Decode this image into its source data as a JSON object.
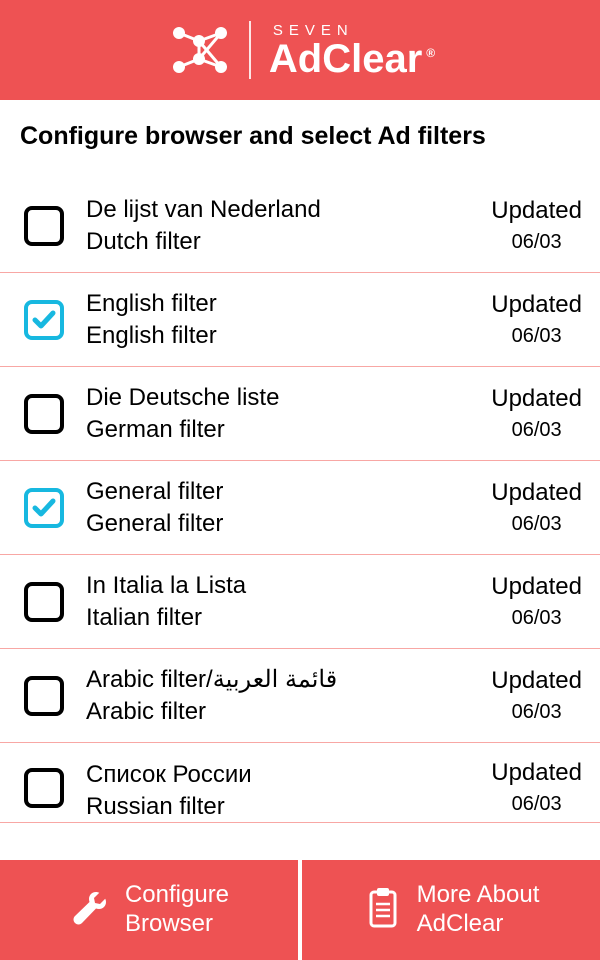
{
  "header": {
    "brand_small": "SEVEN",
    "brand_main": "AdClear",
    "registered": "®"
  },
  "page_title": "Configure browser and select Ad filters",
  "status_label": "Updated",
  "filters": [
    {
      "title": "De lijst van Nederland",
      "subtitle": "Dutch filter",
      "date": "06/03",
      "checked": false
    },
    {
      "title": "English filter",
      "subtitle": "English filter",
      "date": "06/03",
      "checked": true
    },
    {
      "title": "Die Deutsche liste",
      "subtitle": "German filter",
      "date": "06/03",
      "checked": false
    },
    {
      "title": "General filter",
      "subtitle": "General filter",
      "date": "06/03",
      "checked": true
    },
    {
      "title": "In Italia la Lista",
      "subtitle": "Italian filter",
      "date": "06/03",
      "checked": false
    },
    {
      "title": "Arabic filter/قائمة  العربية",
      "subtitle": "Arabic filter",
      "date": "06/03",
      "checked": false
    },
    {
      "title": "Список  России",
      "subtitle": "Russian filter",
      "date": "06/03",
      "checked": false
    }
  ],
  "bottom": {
    "configure_line1": "Configure",
    "configure_line2": "Browser",
    "more_line1": "More About",
    "more_line2": "AdClear"
  }
}
